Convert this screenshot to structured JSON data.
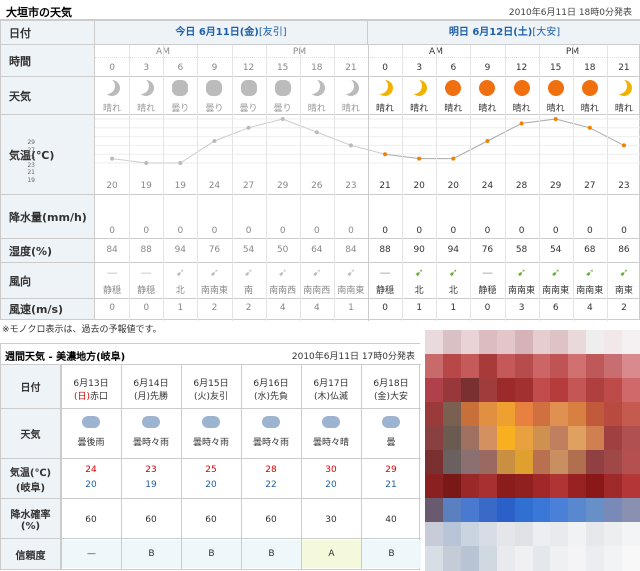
{
  "header": {
    "title": "大垣市の天気",
    "announced": "2010年6月11日 18時0分発表"
  },
  "labels": {
    "date": "日付",
    "time": "時間",
    "weather": "天気",
    "temp": "気温(℃)",
    "precip": "降水量(mm/h)",
    "humidity": "湿度(%)",
    "wind_dir": "風向",
    "wind_speed": "風速(m/s)"
  },
  "today": {
    "title": "今日 6月11日(金)",
    "rokuyo": "[友引]",
    "am": "AM",
    "pm": "PM"
  },
  "tomorrow": {
    "title": "明日 6月12日(土)",
    "rokuyo": "[大安]",
    "am": "AM",
    "pm": "PM"
  },
  "hours": [
    "0",
    "3",
    "6",
    "9",
    "12",
    "15",
    "18",
    "21",
    "0",
    "3",
    "6",
    "9",
    "12",
    "15",
    "18",
    "21"
  ],
  "weather": [
    "晴れ",
    "晴れ",
    "曇り",
    "曇り",
    "曇り",
    "曇り",
    "晴れ",
    "晴れ",
    "晴れ",
    "晴れ",
    "晴れ",
    "晴れ",
    "晴れ",
    "晴れ",
    "晴れ",
    "晴れ"
  ],
  "weather_icons": [
    "moon-icon",
    "moon-icon",
    "cloud-icon",
    "cloud-icon",
    "cloud-icon",
    "cloud-icon",
    "moon-icon",
    "moon-icon",
    "moon-icon",
    "moon-icon",
    "sun-icon",
    "sun-icon",
    "sun-icon",
    "sun-icon",
    "sun-icon",
    "moon-icon"
  ],
  "temp_axis": [
    "29",
    "27",
    "25",
    "23",
    "21",
    "19"
  ],
  "temps": [
    "20",
    "19",
    "19",
    "24",
    "27",
    "29",
    "26",
    "23",
    "21",
    "20",
    "20",
    "24",
    "28",
    "29",
    "27",
    "23"
  ],
  "precip": [
    "0",
    "0",
    "0",
    "0",
    "0",
    "0",
    "0",
    "0",
    "0",
    "0",
    "0",
    "0",
    "0",
    "0",
    "0",
    "0"
  ],
  "humidity": [
    "84",
    "88",
    "94",
    "76",
    "54",
    "50",
    "64",
    "84",
    "88",
    "90",
    "94",
    "76",
    "58",
    "54",
    "68",
    "86"
  ],
  "wind_dir": [
    "静穏",
    "静穏",
    "北",
    "南南東",
    "南",
    "南南西",
    "南南西",
    "南南東",
    "静穏",
    "北",
    "北",
    "静穏",
    "南南東",
    "南南東",
    "南南東",
    "南東"
  ],
  "wind_speed": [
    "0",
    "0",
    "1",
    "2",
    "2",
    "4",
    "4",
    "1",
    "0",
    "1",
    "1",
    "0",
    "3",
    "6",
    "4",
    "2"
  ],
  "footnote": "※モノクロ表示は、過去の予報値です。",
  "weekly": {
    "title": "週間天気 - 美濃地方(岐阜)",
    "announced": "2010年6月11日 17時0分発表",
    "labels": {
      "date": "日付",
      "weather": "天気",
      "temp1": "気温(℃)",
      "temp2": "(岐阜)",
      "rain1": "降水確率",
      "rain2": "(%)",
      "reliability": "信頼度"
    },
    "days": [
      {
        "date": "6月13日",
        "dow": "(日)",
        "rokuyo": "赤口",
        "weather": "曇後雨",
        "hi": "24",
        "lo": "20",
        "rain": "60",
        "rel": "—"
      },
      {
        "date": "6月14日",
        "dow": "(月)",
        "rokuyo": "先勝",
        "weather": "曇時々雨",
        "hi": "23",
        "lo": "19",
        "rain": "60",
        "rel": "B"
      },
      {
        "date": "6月15日",
        "dow": "(火)",
        "rokuyo": "友引",
        "weather": "曇時々雨",
        "hi": "25",
        "lo": "20",
        "rain": "60",
        "rel": "B"
      },
      {
        "date": "6月16日",
        "dow": "(水)",
        "rokuyo": "先負",
        "weather": "曇時々雨",
        "hi": "28",
        "lo": "22",
        "rain": "60",
        "rel": "B"
      },
      {
        "date": "6月17日",
        "dow": "(木)",
        "rokuyo": "仏滅",
        "weather": "曇時々晴",
        "hi": "30",
        "lo": "20",
        "rain": "30",
        "rel": "A"
      },
      {
        "date": "6月18日",
        "dow": "(金)",
        "rokuyo": "大安",
        "weather": "曇",
        "hi": "29",
        "lo": "21",
        "rain": "40",
        "rel": "B"
      }
    ]
  }
}
